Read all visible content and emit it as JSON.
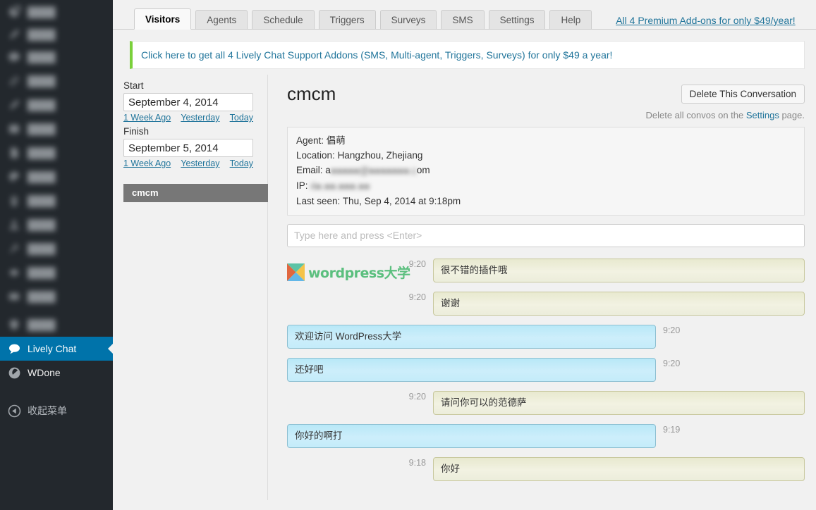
{
  "wp_sidebar": {
    "items": [
      {
        "label": "",
        "icon": "dashboard-icon",
        "redacted": true
      },
      {
        "label": "",
        "icon": "pencil-icon",
        "redacted": true
      },
      {
        "label": "",
        "icon": "comment-icon",
        "redacted": true
      },
      {
        "label": "",
        "icon": "link-icon",
        "redacted": true
      },
      {
        "label": "",
        "icon": "pencil-icon",
        "redacted": true
      },
      {
        "label": "",
        "icon": "media-icon",
        "redacted": true
      },
      {
        "label": "",
        "icon": "page-icon",
        "redacted": true
      },
      {
        "label": "",
        "icon": "appearance-icon",
        "redacted": true
      },
      {
        "label": "",
        "icon": "plugin-icon",
        "redacted": true
      },
      {
        "label": "",
        "icon": "users-icon",
        "redacted": true
      },
      {
        "label": "",
        "icon": "tools-icon",
        "redacted": true
      },
      {
        "label": "",
        "icon": "settings-icon",
        "redacted": true
      },
      {
        "label": "",
        "icon": "box-icon",
        "redacted": true
      },
      {
        "label": "",
        "icon": "shield-icon",
        "redacted": true
      }
    ],
    "lively_chat": {
      "label": "Lively Chat",
      "icon": "chat-bubble-icon"
    },
    "wdone": {
      "label": "WDone",
      "icon": "wdone-icon"
    },
    "collapse": {
      "label": "收起菜单",
      "icon": "collapse-arrow-icon"
    }
  },
  "tabs": [
    {
      "label": "Visitors",
      "active": true
    },
    {
      "label": "Agents",
      "active": false
    },
    {
      "label": "Schedule",
      "active": false
    },
    {
      "label": "Triggers",
      "active": false
    },
    {
      "label": "Surveys",
      "active": false
    },
    {
      "label": "SMS",
      "active": false
    },
    {
      "label": "Settings",
      "active": false
    },
    {
      "label": "Help",
      "active": false
    }
  ],
  "promo_link": "All 4 Premium Add-ons for only $49/year!",
  "banner": {
    "text": "Click here to get all 4 Lively Chat Support Addons (SMS, Multi-agent, Triggers, Surveys) for only $49 a year!"
  },
  "filters": {
    "start_label": "Start",
    "start_value": "September 4, 2014",
    "finish_label": "Finish",
    "finish_value": "September 5, 2014",
    "quick": [
      "1 Week Ago",
      "Yesterday",
      "Today"
    ]
  },
  "conversation_list": [
    {
      "name": "cmcm",
      "selected": true
    }
  ],
  "conversation": {
    "title": "cmcm",
    "delete_button": "Delete This Conversation",
    "delete_note_prefix": "Delete all convos on the ",
    "delete_note_link": "Settings",
    "delete_note_suffix": " page.",
    "info": {
      "agent_label": "Agent:",
      "agent_value": "倡萌",
      "location_label": "Location:",
      "location_value": "Hangzhou, Zhejiang",
      "email_label": "Email:",
      "email_prefix": "a",
      "email_redacted": "●●●●●@●●●●●●●.c",
      "email_suffix": "om",
      "ip_label": "IP:",
      "ip_redacted": "4●.●●.●●●.●●",
      "last_seen_label": "Last seen:",
      "last_seen_value": "Thu, Sep 4, 2014 at 9:18pm"
    },
    "input_placeholder": "Type here and press <Enter>",
    "brand": {
      "text": "wordpress大学",
      "mark": "wpdaxue-diamond-icon"
    },
    "messages": [
      {
        "from": "agent",
        "time": "9:20",
        "text": "很不错的插件哦"
      },
      {
        "from": "agent",
        "time": "9:20",
        "text": "谢谢"
      },
      {
        "from": "visitor",
        "time": "9:20",
        "text": "欢迎访问 WordPress大学"
      },
      {
        "from": "visitor",
        "time": "9:20",
        "text": "还好吧"
      },
      {
        "from": "agent",
        "time": "9:20",
        "text": "请问你可以的范德萨"
      },
      {
        "from": "visitor",
        "time": "9:19",
        "text": "你好的啊打"
      },
      {
        "from": "agent",
        "time": "9:18",
        "text": "你好"
      }
    ]
  },
  "colors": {
    "wp_sidebar_bg": "#23282d",
    "wp_current_blue": "#0073aa",
    "link_blue": "#21759b",
    "banner_green": "#7ad03a",
    "agent_bubble": "#eceddb",
    "visitor_bubble": "#c4ecfa",
    "brand_green": "#5bbf7e"
  }
}
